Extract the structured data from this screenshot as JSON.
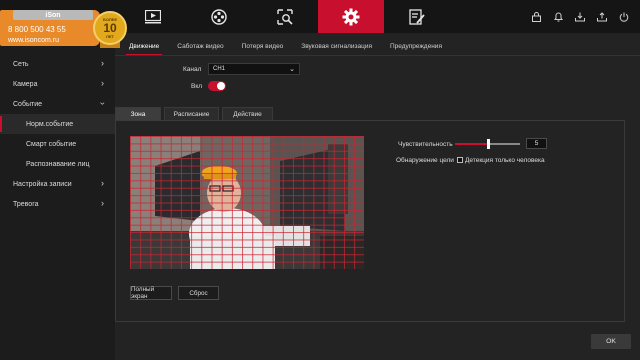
{
  "overlay": {
    "brand": "iSon",
    "phone": "8 800 500 43 55",
    "site": "www.isoncom.ru",
    "seal": {
      "top": "БОЛЕЕ",
      "number": "10",
      "bottom": "ЛЕТ"
    }
  },
  "topnav": {
    "items": [
      {
        "name": "playback",
        "icon": "play-icon"
      },
      {
        "name": "ptz",
        "icon": "reel-icon"
      },
      {
        "name": "search",
        "icon": "search-screen-icon"
      },
      {
        "name": "settings",
        "icon": "gear-icon",
        "active": true
      },
      {
        "name": "info",
        "icon": "document-edit-icon"
      }
    ],
    "right_icons": [
      "lock-icon",
      "bell-icon",
      "download-icon",
      "upload-icon",
      "power-icon"
    ]
  },
  "sidebar": {
    "items": [
      {
        "label": "Си",
        "chevron": false
      },
      {
        "label": "Сеть",
        "chevron": true
      },
      {
        "label": "Камера",
        "chevron": true
      },
      {
        "label": "Событие",
        "chevron": true,
        "open": true
      },
      {
        "label": "Норм.событие",
        "sub": true,
        "active": true
      },
      {
        "label": "Смарт событие",
        "sub": true
      },
      {
        "label": "Распознавание лиц",
        "sub": true
      },
      {
        "label": "Настройка записи",
        "chevron": true
      },
      {
        "label": "Тревога",
        "chevron": true
      }
    ]
  },
  "subtabs": [
    "Движение",
    "Саботаж видео",
    "Потеря видео",
    "Звуковая сигнализация",
    "Предупреждения"
  ],
  "form": {
    "channel_label": "Канал",
    "channel_value": "CH1",
    "enable_label": "Вкл",
    "enabled": true
  },
  "panel_tabs": [
    "Зона",
    "Расписание",
    "Действие"
  ],
  "zone": {
    "sensitivity_label": "Чувствительность",
    "sensitivity_value": "5",
    "sensitivity_level_fraction": 0.5,
    "detect_label": "Обнаружение цели",
    "human_only_label": "Детекция только человека",
    "human_only_checked": false,
    "fullscreen_button": "Полный экран",
    "reset_button": "Сброс"
  },
  "footer": {
    "ok": "OK"
  },
  "colors": {
    "accent": "#c8102e",
    "badge": "#e8892a"
  }
}
